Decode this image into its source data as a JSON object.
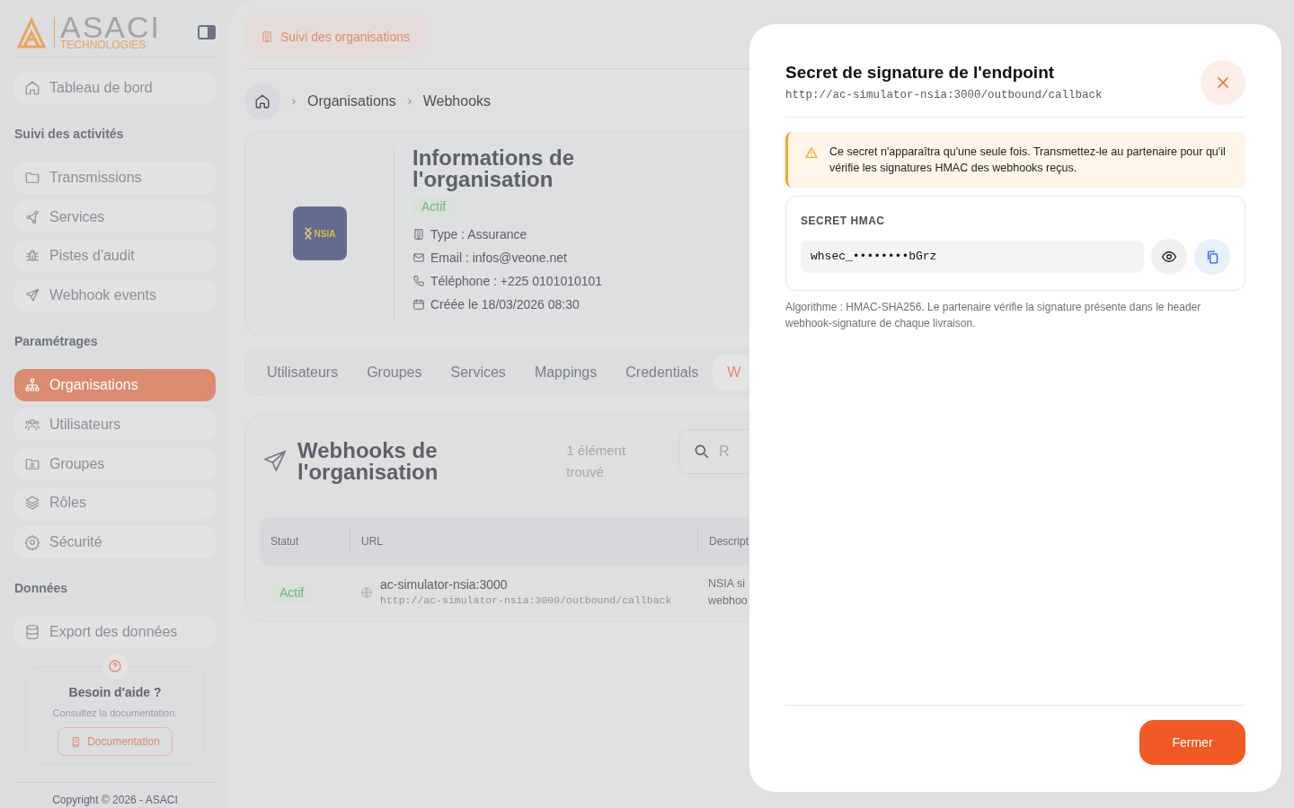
{
  "sidebar": {
    "logo": {
      "name": "ASACI",
      "subtitle": "TECHNOLOGIES"
    },
    "top_items": [
      {
        "label": "Tableau de bord",
        "selected": false
      }
    ],
    "sections": [
      {
        "title": "Suivi des activités",
        "items": [
          {
            "label": "Transmissions",
            "selected": false
          },
          {
            "label": "Services",
            "selected": false
          },
          {
            "label": "Pistes d'audit",
            "selected": false
          },
          {
            "label": "Webhook events",
            "selected": false
          }
        ]
      },
      {
        "title": "Paramétrages",
        "items": [
          {
            "label": "Organisations",
            "selected": true
          },
          {
            "label": "Utilisateurs",
            "selected": false
          },
          {
            "label": "Groupes",
            "selected": false
          },
          {
            "label": "Rôles",
            "selected": false
          },
          {
            "label": "Sécurité",
            "selected": false
          }
        ]
      },
      {
        "title": "Données",
        "items": [
          {
            "label": "Export des données",
            "selected": false
          }
        ]
      }
    ],
    "help": {
      "title": "Besoin d'aide ?",
      "text": "Consultez la documentation.",
      "button": "Documentation"
    },
    "copyright": "Copyright © 2026 - ASACI"
  },
  "header": {
    "page_button": "Suivi des organisations"
  },
  "breadcrumb": [
    "Organisations",
    "Webhooks"
  ],
  "organization": {
    "logo_text": "NSIA",
    "title": "Informations de l'organisation",
    "status": "Actif",
    "details": [
      "Type : Assurance",
      "Email : infos@veone.net",
      "Téléphone : +225 0101010101",
      "Créée le 18/03/2026 08:30"
    ]
  },
  "tabs": [
    {
      "label": "Utilisateurs",
      "selected": false
    },
    {
      "label": "Groupes",
      "selected": false
    },
    {
      "label": "Services",
      "selected": false
    },
    {
      "label": "Mappings",
      "selected": false
    },
    {
      "label": "Credentials",
      "selected": false
    },
    {
      "label": "W",
      "selected": true
    }
  ],
  "webhooks": {
    "title": "Webhooks de l'organisation",
    "count": "1 élément trouvé",
    "search": {
      "placeholder": "R"
    },
    "table": {
      "columns": [
        "Statut",
        "URL",
        "Descript"
      ],
      "rows": [
        {
          "status": "Actif",
          "host": "ac-simulator-nsia:3000",
          "url": "http://ac-simulator-nsia:3000/outbound/callback",
          "description": [
            "NSIA si",
            "webhoo"
          ]
        }
      ]
    }
  },
  "modal": {
    "title": "Secret de signature de l'endpoint",
    "url": "http://ac-simulator-nsia:3000/outbound/callback",
    "warning": "Ce secret n'apparaîtra qu'une seule fois. Transmettez-le au partenaire pour qu'il vérifie les signatures HMAC des webhooks reçus.",
    "secret": {
      "label": "SECRET HMAC",
      "value": "whsec_••••••••bGrz"
    },
    "note": "Algorithme : HMAC-SHA256. Le partenaire vérifie la signature présente dans le header webhook-signature de chaque livraison.",
    "button": "Fermer"
  }
}
